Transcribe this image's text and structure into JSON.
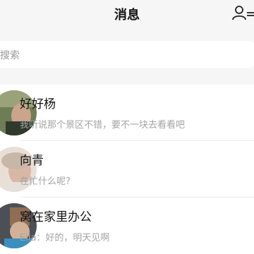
{
  "header": {
    "title": "消息",
    "contacts_icon": "contacts-icon"
  },
  "search": {
    "placeholder": "搜索"
  },
  "conversations": [
    {
      "name": "好好杨",
      "preview": "我听说那个景区不错，要不一块去看看吧"
    },
    {
      "name": "向青",
      "preview": "在忙什么呢?"
    },
    {
      "name": "窝在家里办公",
      "preview": "Ella：好的，明天见啊"
    }
  ]
}
